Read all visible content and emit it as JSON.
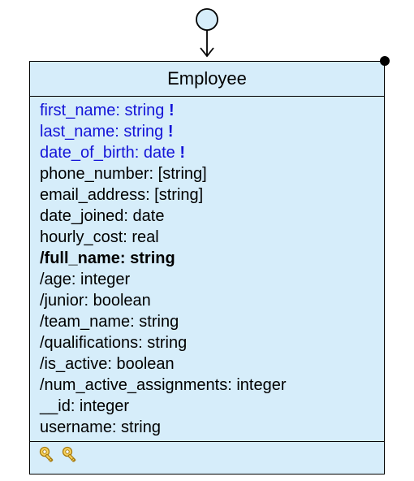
{
  "class": {
    "title": "Employee",
    "attributes": [
      {
        "text": "first_name: string",
        "style": "required",
        "mark": "!"
      },
      {
        "text": "last_name: string",
        "style": "required",
        "mark": "!"
      },
      {
        "text": "date_of_birth: date",
        "style": "required",
        "mark": "!"
      },
      {
        "text": "phone_number: [string]",
        "style": "normal"
      },
      {
        "text": "email_address: [string]",
        "style": "normal"
      },
      {
        "text": "date_joined: date",
        "style": "normal"
      },
      {
        "text": "hourly_cost: real",
        "style": "normal"
      },
      {
        "text": "/full_name: string",
        "style": "bold"
      },
      {
        "text": "/age: integer",
        "style": "normal"
      },
      {
        "text": "/junior: boolean",
        "style": "normal"
      },
      {
        "text": "/team_name: string",
        "style": "normal"
      },
      {
        "text": "/qualifications: string",
        "style": "normal"
      },
      {
        "text": "/is_active: boolean",
        "style": "normal"
      },
      {
        "text": "/num_active_assignments: integer",
        "style": "normal"
      },
      {
        "text": "__id: integer",
        "style": "normal"
      },
      {
        "text": "username: string",
        "style": "normal"
      }
    ]
  }
}
